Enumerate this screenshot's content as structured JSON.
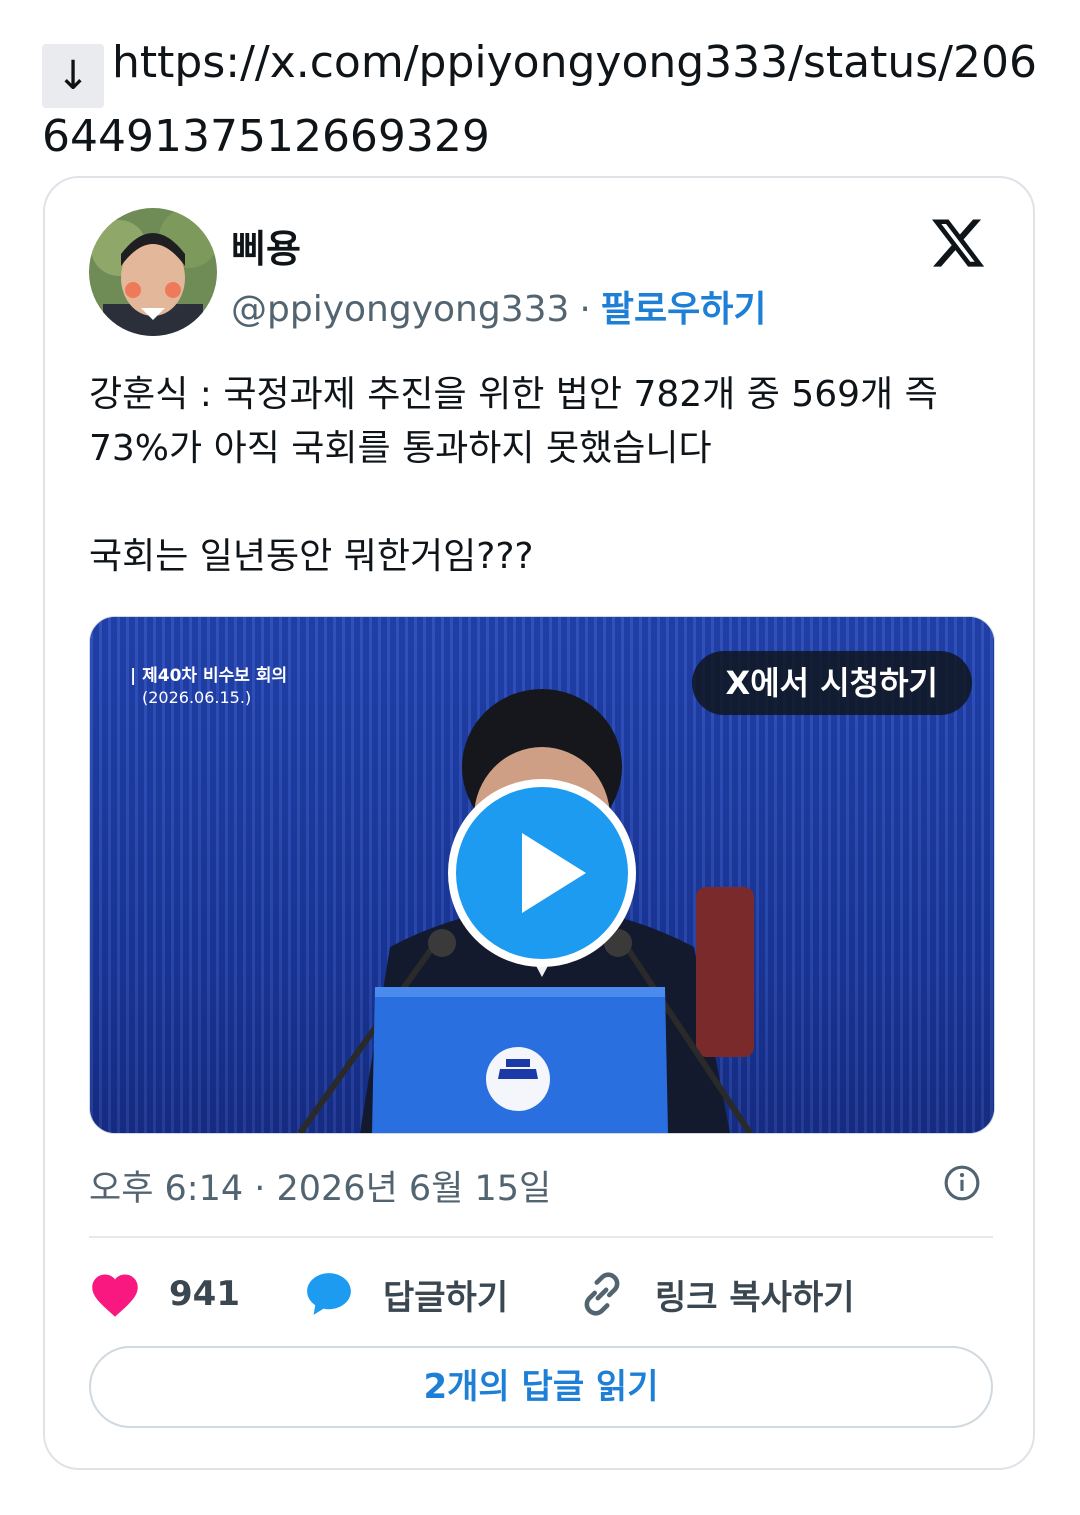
{
  "link": {
    "arrow_glyph": "↓",
    "url": "https://x.com/ppiyongyong333/status/2066449137512669329"
  },
  "tweet": {
    "display_name": "삐용",
    "handle": "@ppiyongyong333",
    "separator": "·",
    "follow_label": "팔로우하기",
    "text": "강훈식 : 국정과제 추진을 위한 법안 782개 중 569개 즉 73%가 아직 국회를 통과하지 못했습니다\n\n국회는 일년동안 뭐한거임???",
    "media": {
      "caption_title": "| 제40차 비수보 회의",
      "caption_date": "(2026.06.15.)",
      "watch_label": "X에서 시청하기",
      "play_icon": "play-icon"
    },
    "timestamp": "오후 6:14 · 2026년 6월 15일",
    "actions": {
      "like_count": "941",
      "reply_label": "답글하기",
      "copy_link_label": "링크 복사하기"
    },
    "read_replies_label": "2개의 답글 읽기"
  },
  "colors": {
    "accent_blue": "#1d9bf0",
    "link_blue": "#1d7fd6",
    "like_pink": "#f91880",
    "reply_blue": "#1d9bf0",
    "secondary_text": "#536471"
  }
}
